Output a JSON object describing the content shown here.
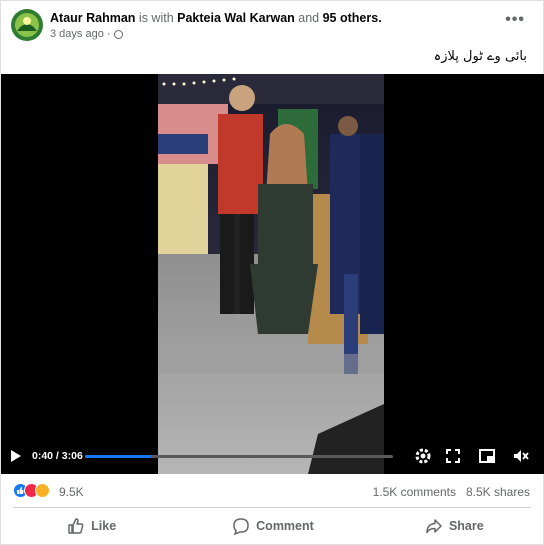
{
  "post": {
    "author": "Ataur Rahman",
    "is_with": "is with",
    "tagged": "Pakteia Wal Karwan",
    "and_text": "and",
    "others": "95 others.",
    "timestamp": "3 days ago",
    "separator": "·",
    "more_label": "•••",
    "caption": "بائی وے ٹول پلازہ"
  },
  "video": {
    "current_time": "0:40",
    "duration": "3:06",
    "time_display": "0:40 / 3:06",
    "progress_fraction": 0.215
  },
  "reactions": {
    "count": "9.5K",
    "types": [
      "like-icon",
      "angry-icon",
      "sad-icon"
    ],
    "comments": "1.5K comments",
    "shares": "8.5K shares"
  },
  "actions": {
    "like": "Like",
    "comment": "Comment",
    "share": "Share"
  },
  "colors": {
    "accent": "#1877f2",
    "muted": "#65676b",
    "angry": "#f02849",
    "sad": "#f7b125"
  }
}
